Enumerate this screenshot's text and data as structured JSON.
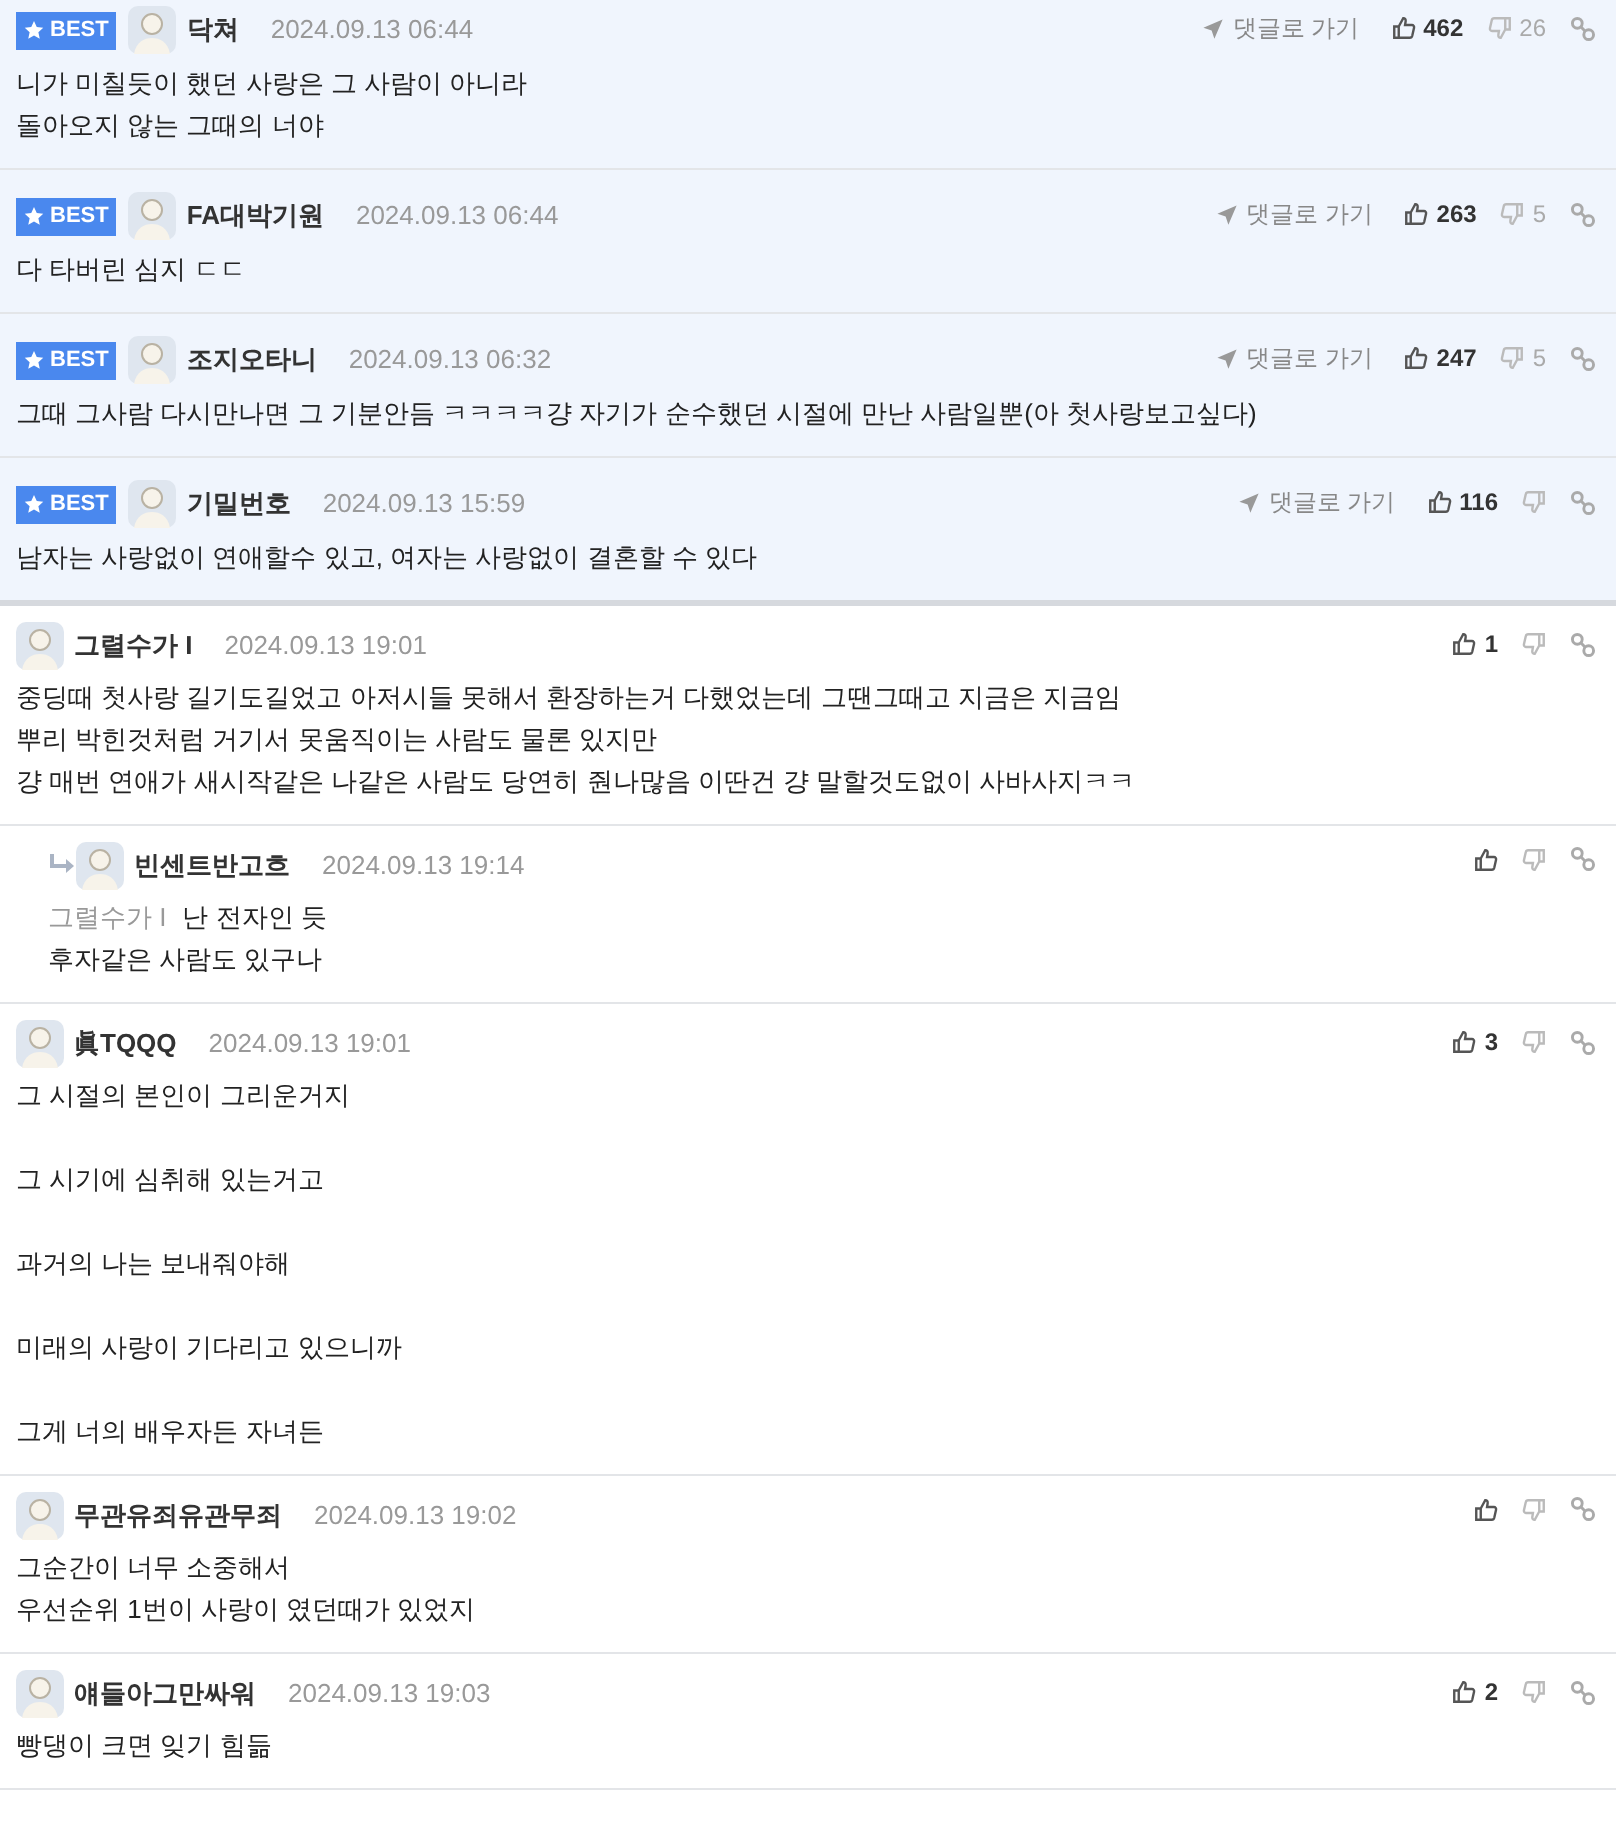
{
  "comments": [
    {
      "badge": "BEST",
      "nickname": "닥쳐",
      "date": "2024.09.13 06:44",
      "goto": "댓글로 가기",
      "likes": "462",
      "dislikes": "26",
      "body": "니가 미칠듯이 했던 사랑은 그 사람이 아니라\n돌아오지 않는 그때의 너야"
    },
    {
      "badge": "BEST",
      "nickname": "FA대박기원",
      "date": "2024.09.13 06:44",
      "goto": "댓글로 가기",
      "likes": "263",
      "dislikes": "5",
      "body": "다 타버린 심지 ㄷㄷ"
    },
    {
      "badge": "BEST",
      "nickname": "조지오타니",
      "date": "2024.09.13 06:32",
      "goto": "댓글로 가기",
      "likes": "247",
      "dislikes": "5",
      "body": "그때 그사람 다시만나면 그 기분안듬 ㅋㅋㅋㅋ걍 자기가 순수했던 시절에 만난 사람일뿐(아 첫사랑보고싶다)"
    },
    {
      "badge": "BEST",
      "nickname": "기밀번호",
      "date": "2024.09.13 15:59",
      "goto": "댓글로 가기",
      "likes": "116",
      "body": "남자는 사랑없이 연애할수 있고, 여자는 사랑없이 결혼할 수 있다"
    },
    {
      "nickname": "그렬수가 I",
      "date": "2024.09.13 19:01",
      "likes": "1",
      "body": "중딩때 첫사랑 길기도길었고 아저시들 못해서 환장하는거 다했었는데 그땐그때고 지금은 지금임\n뿌리 박힌것처럼 거기서 못움직이는 사람도 물론 있지만\n걍 매번 연애가 새시작같은 나같은 사람도 당연히 줜나많음 이딴건 걍 말할것도없이 사바사지ㅋㅋ"
    },
    {
      "kind": "reply",
      "nickname": "빈센트반고흐",
      "date": "2024.09.13 19:14",
      "mention": "그렬수가 I",
      "first_line": "난 전자인 듯",
      "body": "후자같은 사람도 있구나"
    },
    {
      "nickname": "眞TQQQ",
      "date": "2024.09.13 19:01",
      "likes": "3",
      "body": "그 시절의 본인이 그리운거지\n\n그 시기에 심취해 있는거고\n\n과거의 나는 보내줘야해\n\n미래의 사랑이 기다리고 있으니까\n\n그게 너의 배우자든 자녀든"
    },
    {
      "nickname": "무관유죄유관무죄",
      "date": "2024.09.13 19:02",
      "body": "그순간이 너무 소중해서\n우선순위 1번이 사랑이 였던때가 있었지"
    },
    {
      "nickname": "얘들아그만싸워",
      "date": "2024.09.13 19:03",
      "likes": "2",
      "body": "빵댕이 크면 잊기 힘듦"
    }
  ]
}
